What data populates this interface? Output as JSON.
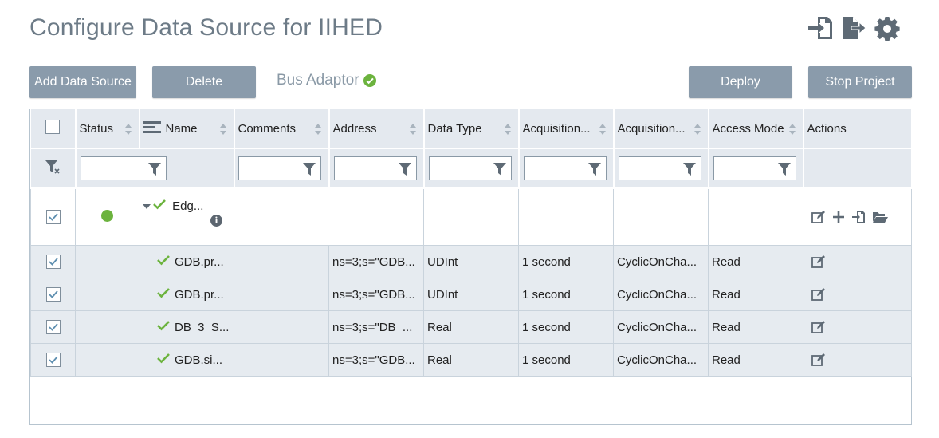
{
  "page": {
    "title": "Configure Data Source for IIHED",
    "top_icons": [
      "import-icon",
      "export-icon",
      "gear-icon"
    ]
  },
  "toolbar": {
    "add_label": "Add Data Source",
    "delete_label": "Delete",
    "bus_adaptor": "Bus Adaptor",
    "deploy_label": "Deploy",
    "stop_label": "Stop Project"
  },
  "colors": {
    "accent_button": "#8a9bab",
    "status_green": "#6cb33e",
    "header_bg": "#e4e9ef",
    "row_bg": "#e6ebf0"
  },
  "grid": {
    "columns": [
      "Status",
      "Name",
      "Comments",
      "Address",
      "Data Type",
      "Acquisition...",
      "Acquisition...",
      "Access Mode",
      "Actions"
    ],
    "parent": {
      "name": "Edg..."
    },
    "rows": [
      {
        "name": "GDB.pr...",
        "comments": "",
        "address": "ns=3;s=\"GDB...",
        "data_type": "UDInt",
        "acq_cycle": "1 second",
        "acq_mode": "CyclicOnCha...",
        "access": "Read"
      },
      {
        "name": "GDB.pr...",
        "comments": "",
        "address": "ns=3;s=\"GDB...",
        "data_type": "UDInt",
        "acq_cycle": "1 second",
        "acq_mode": "CyclicOnCha...",
        "access": "Read"
      },
      {
        "name": "DB_3_S...",
        "comments": "",
        "address": "ns=3;s=\"DB_...",
        "data_type": "Real",
        "acq_cycle": "1 second",
        "acq_mode": "CyclicOnCha...",
        "access": "Read"
      },
      {
        "name": "GDB.si...",
        "comments": "",
        "address": "ns=3;s=\"GDB...",
        "data_type": "Real",
        "acq_cycle": "1 second",
        "acq_mode": "CyclicOnCha...",
        "access": "Read"
      }
    ]
  }
}
